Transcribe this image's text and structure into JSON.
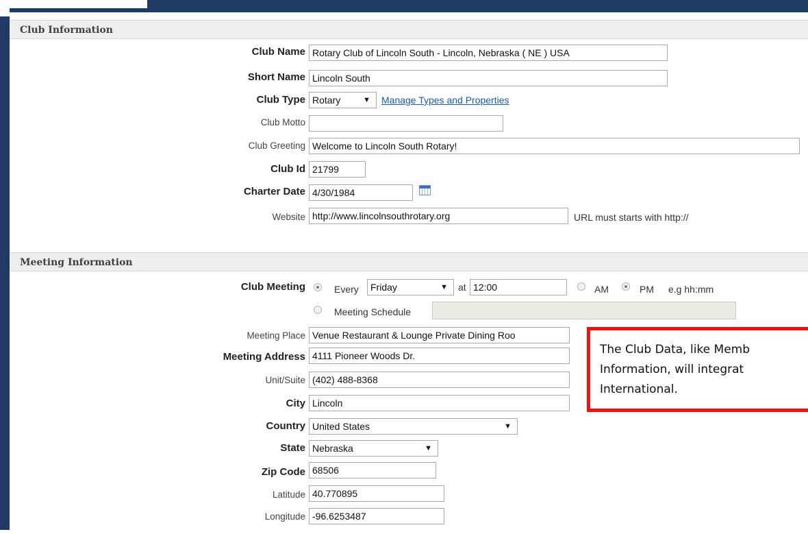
{
  "club_info": {
    "header": "Club Information",
    "club_name": {
      "label": "Club Name",
      "value": "Rotary Club of Lincoln South - Lincoln, Nebraska ( NE ) USA"
    },
    "short_name": {
      "label": "Short Name",
      "value": "Lincoln South"
    },
    "club_type": {
      "label": "Club Type",
      "value": "Rotary",
      "manage_link": "Manage Types and Properties"
    },
    "club_motto": {
      "label": "Club Motto",
      "value": ""
    },
    "club_greeting": {
      "label": "Club Greeting",
      "value": "Welcome to Lincoln South Rotary!"
    },
    "club_id": {
      "label": "Club Id",
      "value": "21799"
    },
    "charter_date": {
      "label": "Charter Date",
      "value": "4/30/1984"
    },
    "website": {
      "label": "Website",
      "value": "http://www.lincolnsouthrotary.org",
      "hint": "URL must starts with http://"
    }
  },
  "meeting_info": {
    "header": "Meeting Information",
    "club_meeting": {
      "label": "Club Meeting",
      "every_label": "Every",
      "day": "Friday",
      "at_label": "at",
      "time": "12:00",
      "am_label": "AM",
      "pm_label": "PM",
      "format_hint": "e.g hh:mm",
      "schedule_label": "Meeting Schedule",
      "schedule_value": ""
    },
    "meeting_place": {
      "label": "Meeting Place",
      "value": "Venue Restaurant & Lounge Private Dining Roo"
    },
    "meeting_address": {
      "label": "Meeting Address",
      "value": "4111 Pioneer Woods Dr."
    },
    "unit_suite": {
      "label": "Unit/Suite",
      "value": "(402) 488-8368"
    },
    "city": {
      "label": "City",
      "value": "Lincoln"
    },
    "country": {
      "label": "Country",
      "value": "United States"
    },
    "state": {
      "label": "State",
      "value": "Nebraska"
    },
    "zip": {
      "label": "Zip Code",
      "value": "68506"
    },
    "latitude": {
      "label": "Latitude",
      "value": "40.770895"
    },
    "longitude": {
      "label": "Longitude",
      "value": "-96.6253487"
    }
  },
  "callout": {
    "line1": "The Club Data, like Memb",
    "line2": "Information, will integrat",
    "line3": "International."
  },
  "icons": {
    "dropdown": "▼"
  },
  "colors": {
    "frame": "#1f3a63",
    "callout_border": "#ee1111",
    "link": "#1a5aa8",
    "section_bg": "#eeeeee"
  }
}
